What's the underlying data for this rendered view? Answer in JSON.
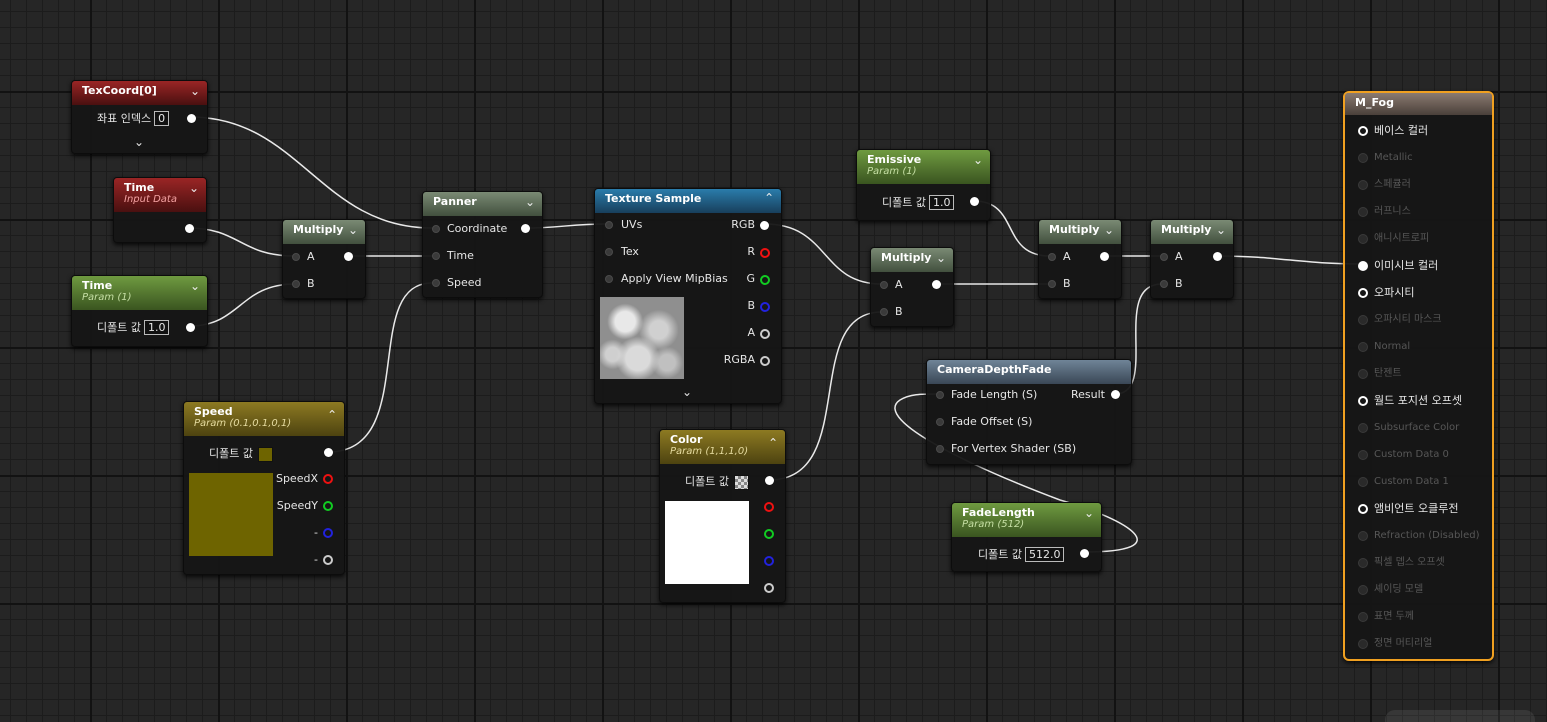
{
  "nodes": {
    "texcoord": {
      "title": "TexCoord[0]",
      "index_label": "좌표 인덱스",
      "index_value": "0"
    },
    "time_input": {
      "title": "Time",
      "subtitle": "Input Data"
    },
    "time_param": {
      "title": "Time",
      "subtitle": "Param (1)",
      "default_label": "디폴트 값",
      "default_value": "1.0"
    },
    "multiply1": {
      "title": "Multiply",
      "pin_a": "A",
      "pin_b": "B"
    },
    "panner": {
      "title": "Panner",
      "pin_coordinate": "Coordinate",
      "pin_time": "Time",
      "pin_speed": "Speed"
    },
    "texture_sample": {
      "title": "Texture Sample",
      "in_uvs": "UVs",
      "in_tex": "Tex",
      "in_mipbias": "Apply View MipBias",
      "out_rgb": "RGB",
      "out_r": "R",
      "out_g": "G",
      "out_b": "B",
      "out_a": "A",
      "out_rgba": "RGBA"
    },
    "speed": {
      "title": "Speed",
      "subtitle": "Param (0.1,0.1,0,1)",
      "default_label": "디폴트 값",
      "out_x": "SpeedX",
      "out_y": "SpeedY",
      "out_z": "-",
      "out_w": "-",
      "swatch_color": "#6e6400"
    },
    "color": {
      "title": "Color",
      "subtitle": "Param (1,1,1,0)",
      "default_label": "디폴트 값",
      "swatch_color": "#ffffff"
    },
    "emissive": {
      "title": "Emissive",
      "subtitle": "Param (1)",
      "default_label": "디폴트 값",
      "default_value": "1.0"
    },
    "multiply2": {
      "title": "Multiply",
      "pin_a": "A",
      "pin_b": "B"
    },
    "multiply3": {
      "title": "Multiply",
      "pin_a": "A",
      "pin_b": "B"
    },
    "multiply4": {
      "title": "Multiply",
      "pin_a": "A",
      "pin_b": "B"
    },
    "camera_depth_fade": {
      "title": "CameraDepthFade",
      "in_fade_length": "Fade Length (S)",
      "in_fade_offset": "Fade Offset (S)",
      "in_vertex_shader": "For Vertex Shader (SB)",
      "out_result": "Result"
    },
    "fade_length": {
      "title": "FadeLength",
      "subtitle": "Param (512)",
      "default_label": "디폴트 값",
      "default_value": "512.0"
    },
    "material": {
      "title": "M_Fog",
      "inputs": [
        {
          "label": "베이스 컬러",
          "active": true
        },
        {
          "label": "Metallic",
          "active": false
        },
        {
          "label": "스페큘러",
          "active": false
        },
        {
          "label": "러프니스",
          "active": false
        },
        {
          "label": "애니시트로피",
          "active": false
        },
        {
          "label": "이미시브 컬러",
          "active": true
        },
        {
          "label": "오파시티",
          "active": true
        },
        {
          "label": "오파시티 마스크",
          "active": false
        },
        {
          "label": "Normal",
          "active": false
        },
        {
          "label": "탄젠트",
          "active": false
        },
        {
          "label": "월드 포지션 오프셋",
          "active": true
        },
        {
          "label": "Subsurface Color",
          "active": false
        },
        {
          "label": "Custom Data 0",
          "active": false
        },
        {
          "label": "Custom Data 1",
          "active": false
        },
        {
          "label": "앰비언트 오클루전",
          "active": true
        },
        {
          "label": "Refraction (Disabled)",
          "active": false
        },
        {
          "label": "픽셀 뎁스 오프셋",
          "active": false
        },
        {
          "label": "셰이딩 모델",
          "active": false
        },
        {
          "label": "표면 두께",
          "active": false
        },
        {
          "label": "정면 머티리얼",
          "active": false
        }
      ]
    }
  },
  "colors": {
    "selection": "#f0a020",
    "wire": "#ffffff"
  }
}
